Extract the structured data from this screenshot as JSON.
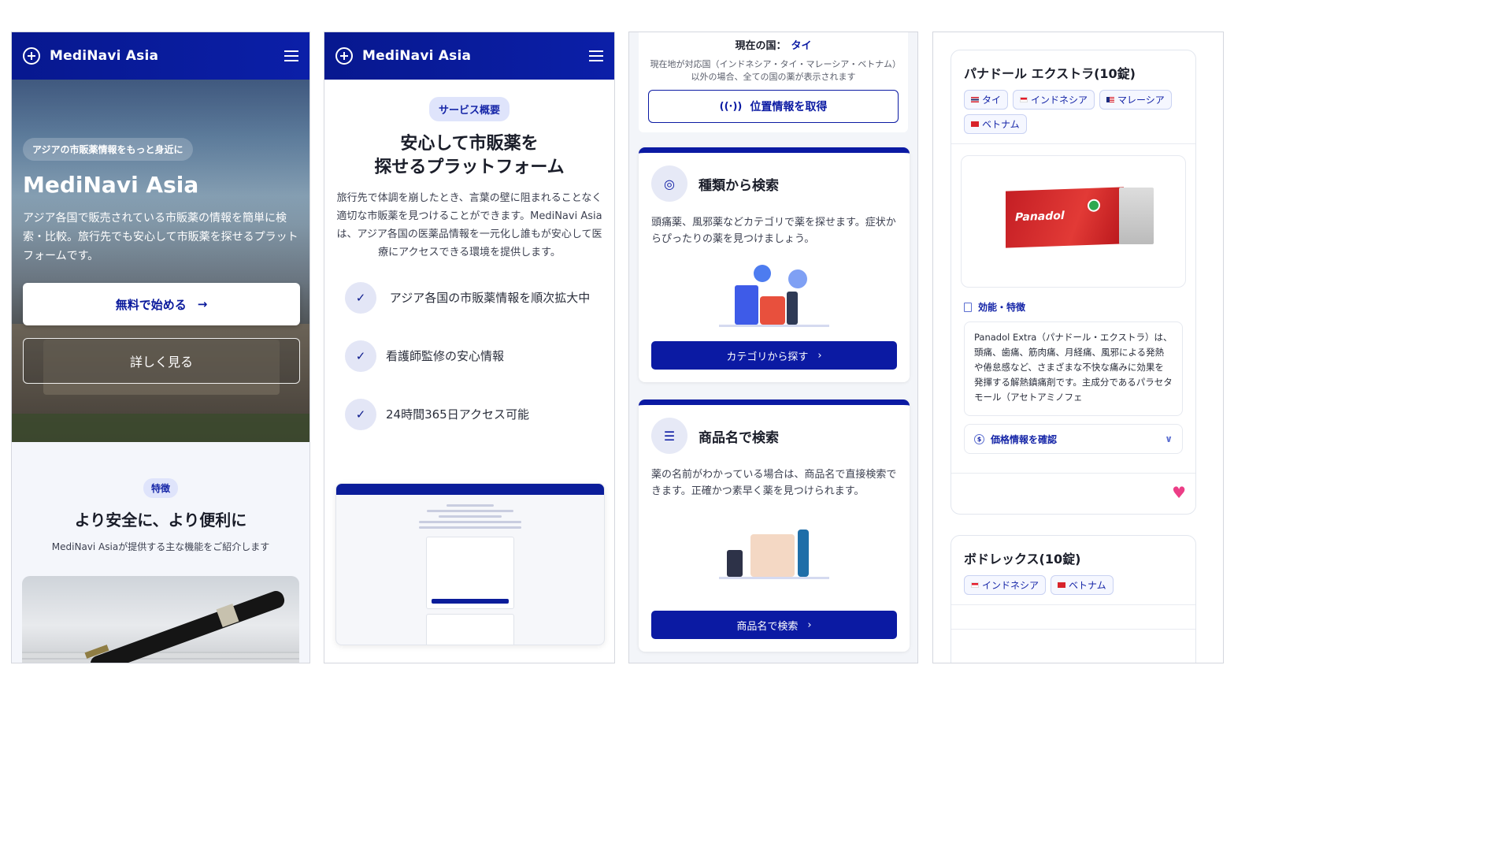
{
  "app": {
    "name": "MediNavi Asia"
  },
  "hero": {
    "badge": "アジアの市販薬情報をもっと身近に",
    "title": "MediNavi Asia",
    "description": "アジア各国で販売されている市販薬の情報を簡単に検索・比較。旅行先でも安心して市販薬を探せるプラットフォームです。",
    "cta_primary": "無料で始める",
    "cta_primary_arrow": "→",
    "cta_secondary": "詳しく見る"
  },
  "features": {
    "pill": "特徴",
    "title": "より安全に、より便利に",
    "subtitle": "MediNavi Asiaが提供する主な機能をご紹介します"
  },
  "overview": {
    "pill": "サービス概要",
    "title_line1": "安心して市販薬を",
    "title_line2": "探せるプラットフォーム",
    "description": "旅行先で体調を崩したとき、言葉の壁に阻まれることなく適切な市販薬を見つけることができます。MediNavi Asiaは、アジア各国の医薬品情報を一元化し誰もが安心して医療にアクセスできる環境を提供します。",
    "checks": [
      {
        "text": "アジア各国の市販薬情報を順次拡大中"
      },
      {
        "text": "看護師監修の安心情報"
      },
      {
        "text": "24時間365日アクセス可能"
      }
    ],
    "check_icon": "✓"
  },
  "location": {
    "current_label": "現在の国：",
    "current_country": "タイ",
    "note": "現在地が対応国（インドネシア・タイ・マレーシア・ベトナム）以外の場合、全ての国の薬が表示されます",
    "button": "位置情報を取得",
    "button_icon": "wifi-icon"
  },
  "search_cards": {
    "category": {
      "title": "種類から検索",
      "description": "頭痛薬、風邪薬などカテゴリで薬を探せます。症状からぴったりの薬を見つけましょう。",
      "button": "カテゴリから探す",
      "icon": "search-icon"
    },
    "name": {
      "title": "商品名で検索",
      "description": "薬の名前がわかっている場合は、商品名で直接検索できます。正確かつ素早く薬を見つけられます。",
      "button": "商品名で検索",
      "icon": "list-icon"
    },
    "chevron": "›"
  },
  "products": [
    {
      "title": "パナドール エクストラ(10錠)",
      "countries": [
        "タイ",
        "インドネシア",
        "マレーシア",
        "ベトナム"
      ],
      "image_text": "Panadol",
      "effect_label": "効能・特徴",
      "effect_text": "Panadol Extra（パナドール・エクストラ）は、頭痛、歯痛、筋肉痛、月経痛、風邪による発熱や倦怠感など、さまざまな不快な痛みに効果を発揮する解熱鎮痛剤です。主成分であるパラセタモール（アセトアミノフェ",
      "price_label": "価格情報を確認",
      "favorite": true
    },
    {
      "title": "ボドレックス(10錠)",
      "countries": [
        "インドネシア",
        "ベトナム"
      ]
    }
  ],
  "colors": {
    "primary": "#0b1aa3",
    "header": "#07188f",
    "accent_pink": "#ec3d86"
  }
}
